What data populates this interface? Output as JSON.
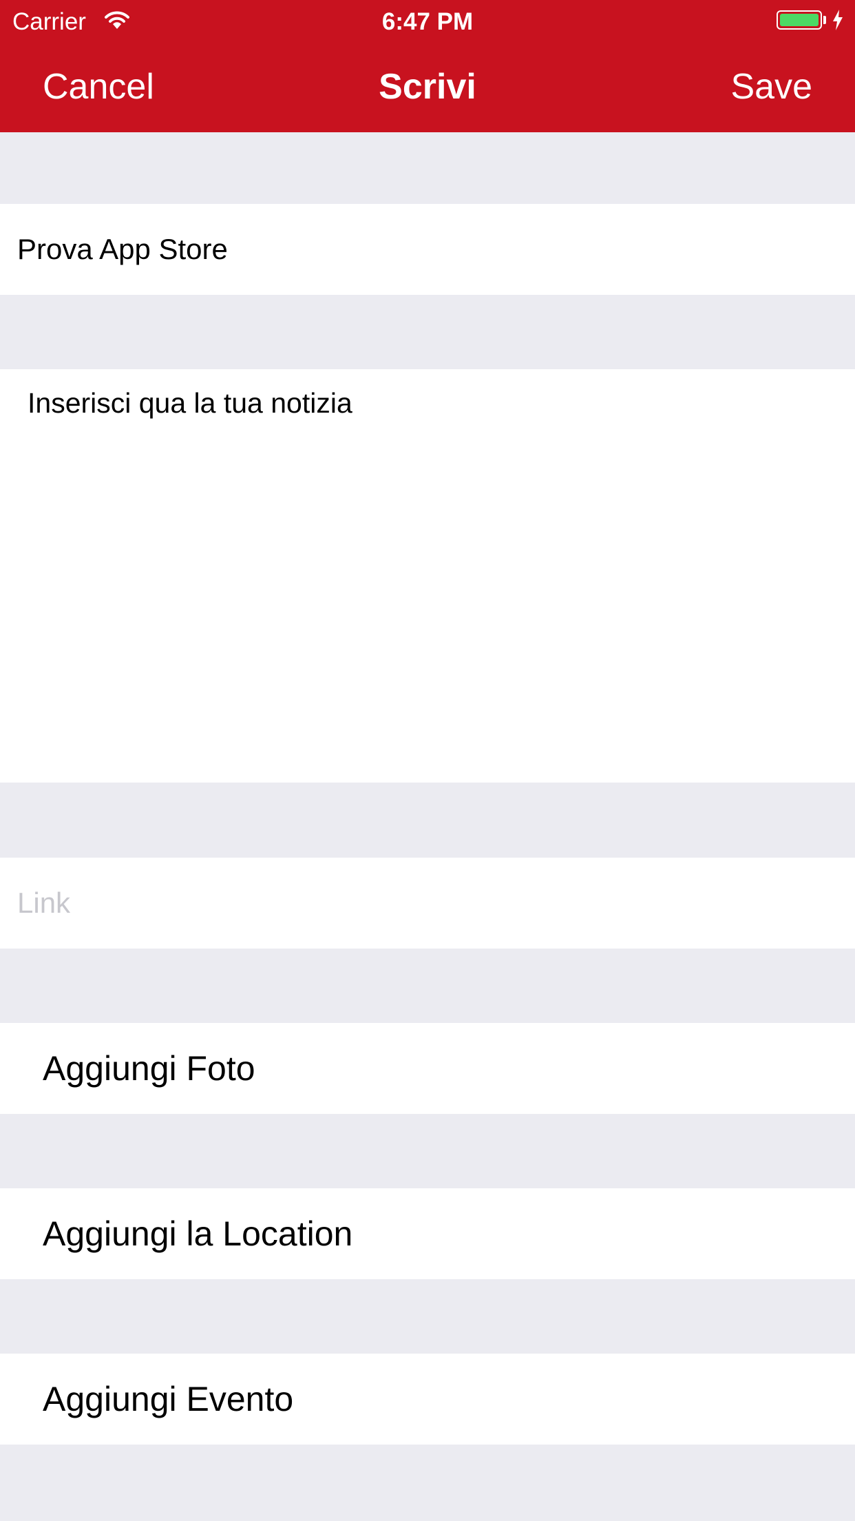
{
  "status_bar": {
    "carrier": "Carrier",
    "time": "6:47 PM",
    "battery_level": 1.0,
    "charging": true,
    "wifi_icon": "wifi-icon",
    "battery_icon": "battery-icon",
    "charging_icon": "bolt-icon"
  },
  "nav": {
    "cancel_label": "Cancel",
    "title": "Scrivi",
    "save_label": "Save"
  },
  "form": {
    "title_value": "Prova App Store",
    "body_value": "Inserisci qua la tua notizia",
    "link_value": "",
    "link_placeholder": "Link"
  },
  "actions": {
    "add_photo": "Aggiungi Foto",
    "add_location": "Aggiungi la Location",
    "add_event": "Aggiungi Evento"
  },
  "colors": {
    "nav_background": "#c8121f",
    "nav_text": "#ffffff",
    "page_background": "#ebebf1",
    "cell_background": "#ffffff",
    "placeholder": "#c7c7cd",
    "battery_fill": "#4cd964"
  }
}
